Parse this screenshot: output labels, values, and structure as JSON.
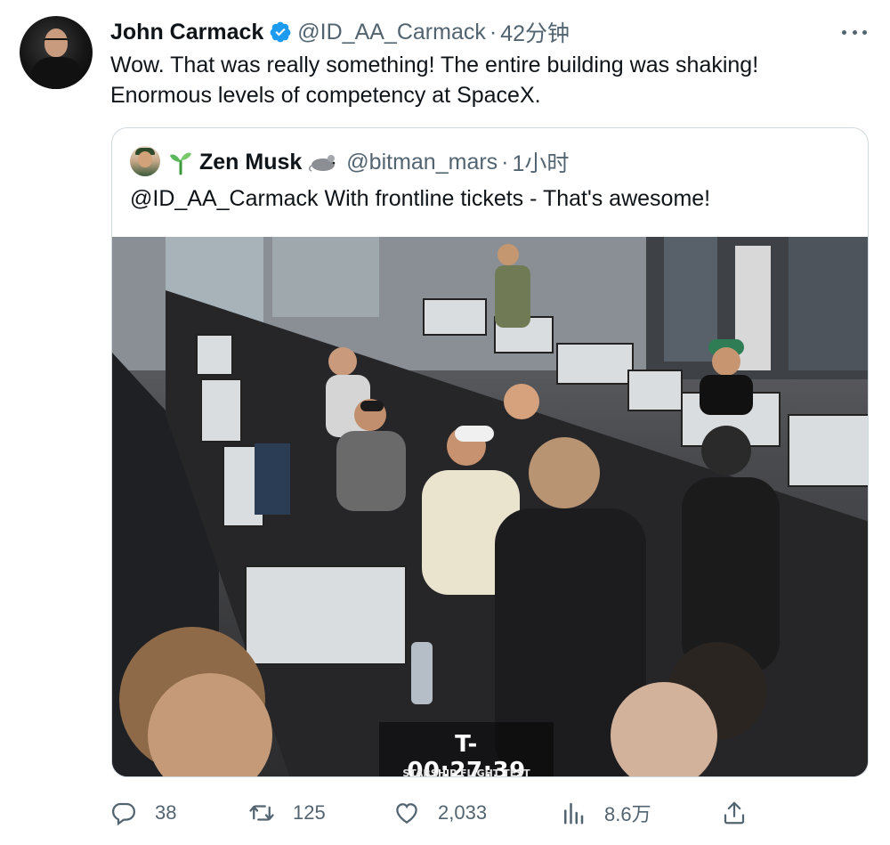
{
  "tweet": {
    "display_name": "John Carmack",
    "handle": "@ID_AA_Carmack",
    "separator": "·",
    "time": "42分钟",
    "text_line1": "Wow. That was really something! The entire building was shaking!",
    "text_line2": "Enormous levels of competency at SpaceX."
  },
  "quote": {
    "display_name": "Zen Musk",
    "handle": "@bitman_mars",
    "separator": "·",
    "time": "1小时",
    "text": "@ID_AA_Carmack With frontline tickets - That's awesome!",
    "image_overlay": {
      "countdown": "T-00:27:39",
      "caption": "STARSHIP FLIGHT TEST"
    }
  },
  "actions": {
    "replies": "38",
    "retweets": "125",
    "likes": "2,033",
    "views": "8.6万"
  },
  "colors": {
    "text": "#0f1419",
    "secondary": "#536471",
    "verified": "#1d9bf0",
    "border": "#cfd9de"
  },
  "icons": {
    "verified": "verified-badge-icon",
    "more": "more-dots-icon",
    "reply": "reply-icon",
    "retweet": "retweet-icon",
    "like": "heart-icon",
    "views": "views-icon",
    "share": "share-icon"
  }
}
